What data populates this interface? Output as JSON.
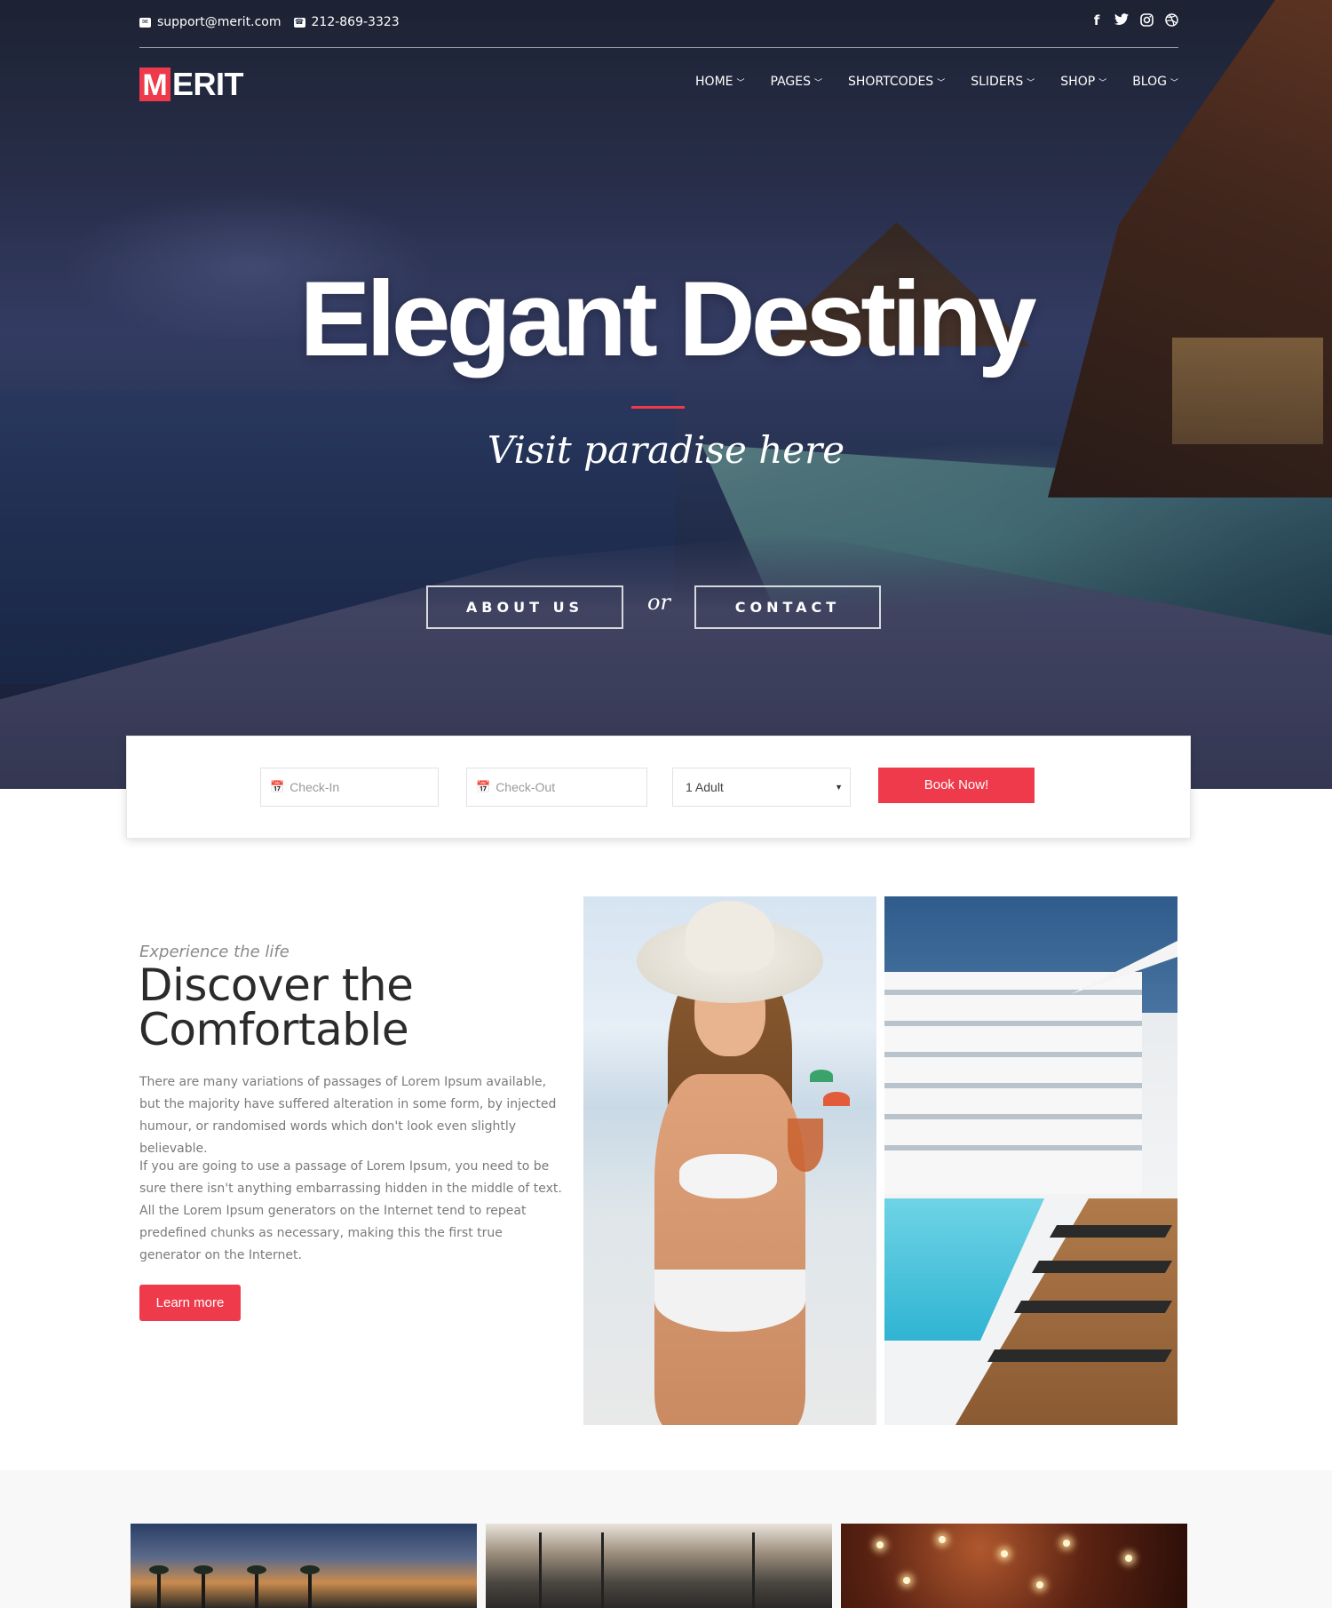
{
  "topbar": {
    "email": "support@merit.com",
    "phone": "212-869-3323",
    "social": [
      "facebook-icon",
      "twitter-icon",
      "instagram-icon",
      "dribbble-icon"
    ]
  },
  "brand": {
    "logo_letter": "M",
    "logo_rest": "ERIT",
    "accent": "#ef3a4b"
  },
  "nav": {
    "items": [
      {
        "label": "HOME"
      },
      {
        "label": "PAGES"
      },
      {
        "label": "SHORTCODES"
      },
      {
        "label": "SLIDERS"
      },
      {
        "label": "SHOP"
      },
      {
        "label": "BLOG"
      }
    ]
  },
  "hero": {
    "title": "Elegant Destiny",
    "subtitle": "Visit paradise here",
    "about_label": "ABOUT US",
    "or_label": "or",
    "contact_label": "CONTACT"
  },
  "booking": {
    "checkin_placeholder": "Check-In",
    "checkout_placeholder": "Check-Out",
    "guests_value": "1 Adult",
    "book_label": "Book Now!"
  },
  "about": {
    "pre": "Experience the life",
    "title": "Discover the Comfortable",
    "p1": "There are many variations of passages of Lorem Ipsum available, but the majority have suffered alteration in some form, by injected humour, or randomised words which don't look even slightly believable.",
    "p2": "If you are going to use a passage of Lorem Ipsum, you need to be sure there isn't anything embarrassing hidden in the middle of text. All the Lorem Ipsum generators on the Internet tend to repeat predefined chunks as necessary, making this the first true generator on the Internet.",
    "button": "Learn more"
  }
}
